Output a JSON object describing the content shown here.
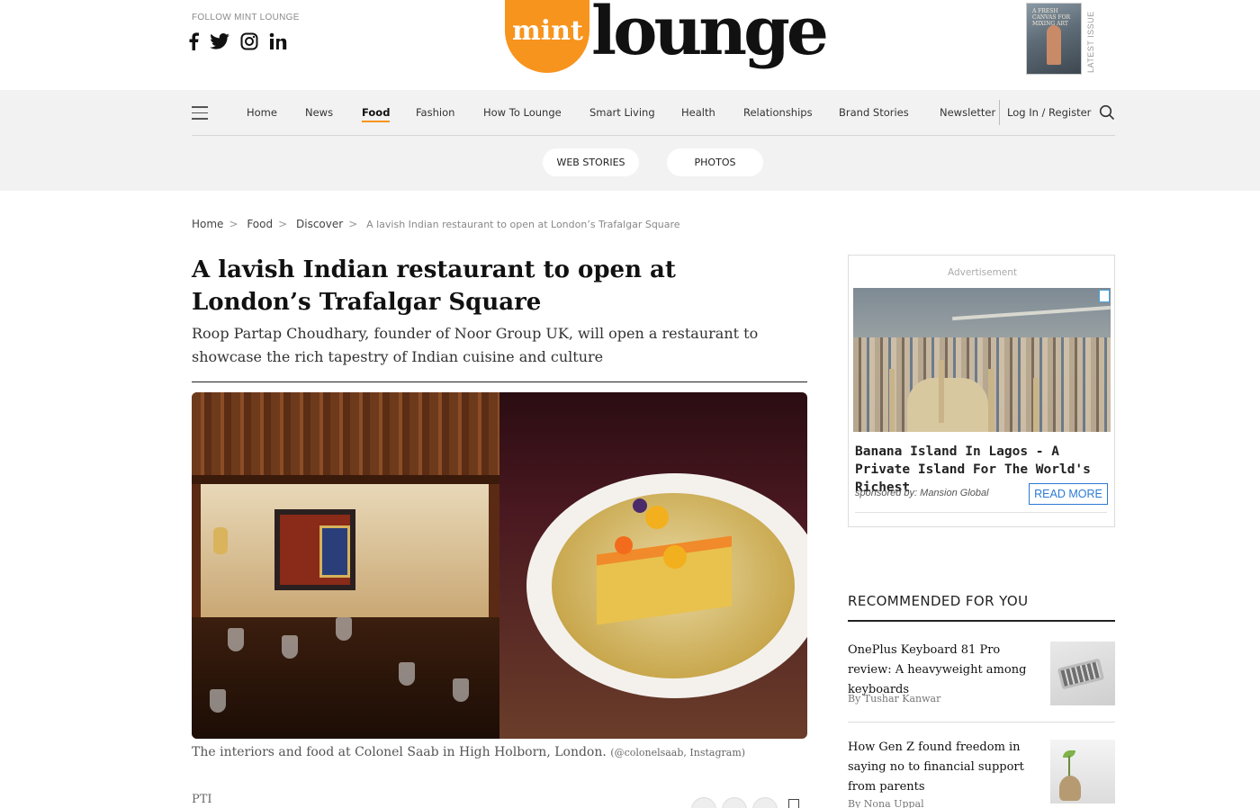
{
  "header": {
    "follow_label": "FOLLOW MINT LOUNGE",
    "social": [
      "facebook-icon",
      "twitter-icon",
      "instagram-icon",
      "linkedin-icon"
    ],
    "logo_mint": "mint",
    "logo_lounge": "lounge",
    "latest_issue_label": "LATEST ISSUE",
    "issue_cover_text": "A FRESH CANVAS FOR MIXING ART"
  },
  "nav": {
    "items": [
      "Home",
      "News",
      "Food",
      "Fashion",
      "How To Lounge",
      "Smart Living",
      "Health",
      "Relationships",
      "Brand Stories"
    ],
    "active": "Food",
    "newsletter": "Newsletter",
    "login": "Log In / Register",
    "pills": [
      "WEB STORIES",
      "PHOTOS"
    ]
  },
  "breadcrumb": [
    "Home",
    "Food",
    "Discover",
    "A lavish Indian restaurant to open at London’s Trafalgar Square"
  ],
  "article": {
    "headline": "A lavish Indian restaurant to open at London’s Trafalgar Square",
    "summary": "Roop Partap Choudhary, founder of Noor Group UK, will open a restaurant to showcase the rich tapestry of Indian cuisine and culture",
    "caption": "The interiors and food at Colonel Saab in High Holborn, London.",
    "caption_credit": "(@colonelsaab, Instagram)",
    "byline": "PTI"
  },
  "ad": {
    "label": "Advertisement",
    "title": "Banana Island In Lagos - A Private Island For The World's Richest",
    "sponsor": "sponsored by: Mansion Global",
    "cta": "READ MORE"
  },
  "recommended": {
    "title": "RECOMMENDED FOR YOU",
    "items": [
      {
        "title": "OnePlus Keyboard 81 Pro review: A heavyweight among keyboards",
        "author": "By Tushar Kanwar"
      },
      {
        "title": "How Gen Z found freedom in saying no to financial support from parents",
        "author": "By Nona Uppal"
      }
    ]
  },
  "colors": {
    "accent": "#f7941d",
    "nav_bg": "#f2f2f2",
    "ad_link": "#2c7ad6"
  }
}
